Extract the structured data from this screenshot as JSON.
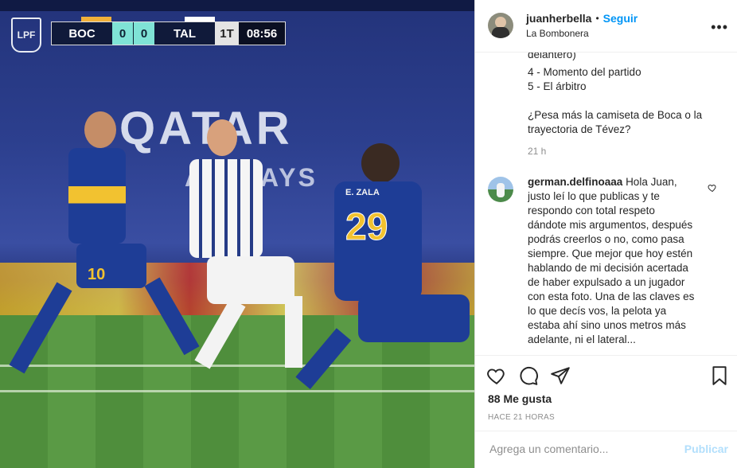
{
  "photo": {
    "league_logo_text": "LPF",
    "scoreboard": {
      "home_team": "BOC",
      "home_score": "0",
      "away_score": "0",
      "away_team": "TAL",
      "period": "1T",
      "clock": "08:56",
      "home_color": "#f2b13a",
      "away_color": "#ffffff"
    },
    "ad_text_main": "QATAR",
    "ad_text_sub": "AIRWAYS",
    "player_numbers": [
      "10",
      "29"
    ],
    "player_name_back": "E. ZALA"
  },
  "post": {
    "author": {
      "username": "juanherbella",
      "follow_label": "Seguir",
      "location": "La Bombonera"
    },
    "caption_lines": [
      "delantero)",
      "4 - Momento del partido",
      "5 - El árbitro",
      "",
      "¿Pesa más la camiseta de Boca o la trayectoria de Tévez?"
    ],
    "caption_time": "21 h",
    "comment": {
      "username": "german.delfinoaaa",
      "text": "Hola Juan, justo leí lo que publicas y te respondo con total respeto dándote mis argumentos, después podrás creerlos o no, como pasa siempre. Que mejor que hoy estén hablando de mi decisión acertada de haber expulsado a un jugador con esta foto. Una de las claves es lo que decís vos, la pelota ya estaba ahí sino unos metros más adelante, ni el lateral..."
    },
    "likes": "88 Me gusta",
    "posted_ago": "HACE 21 HORAS",
    "comment_placeholder": "Agrega un comentario...",
    "publish_label": "Publicar"
  },
  "colors": {
    "link_blue": "#0095f6",
    "publish_disabled": "#b2dffc",
    "muted_text": "#8e8e8e",
    "boca_blue": "#1e3d96",
    "boca_gold": "#f2c230"
  }
}
